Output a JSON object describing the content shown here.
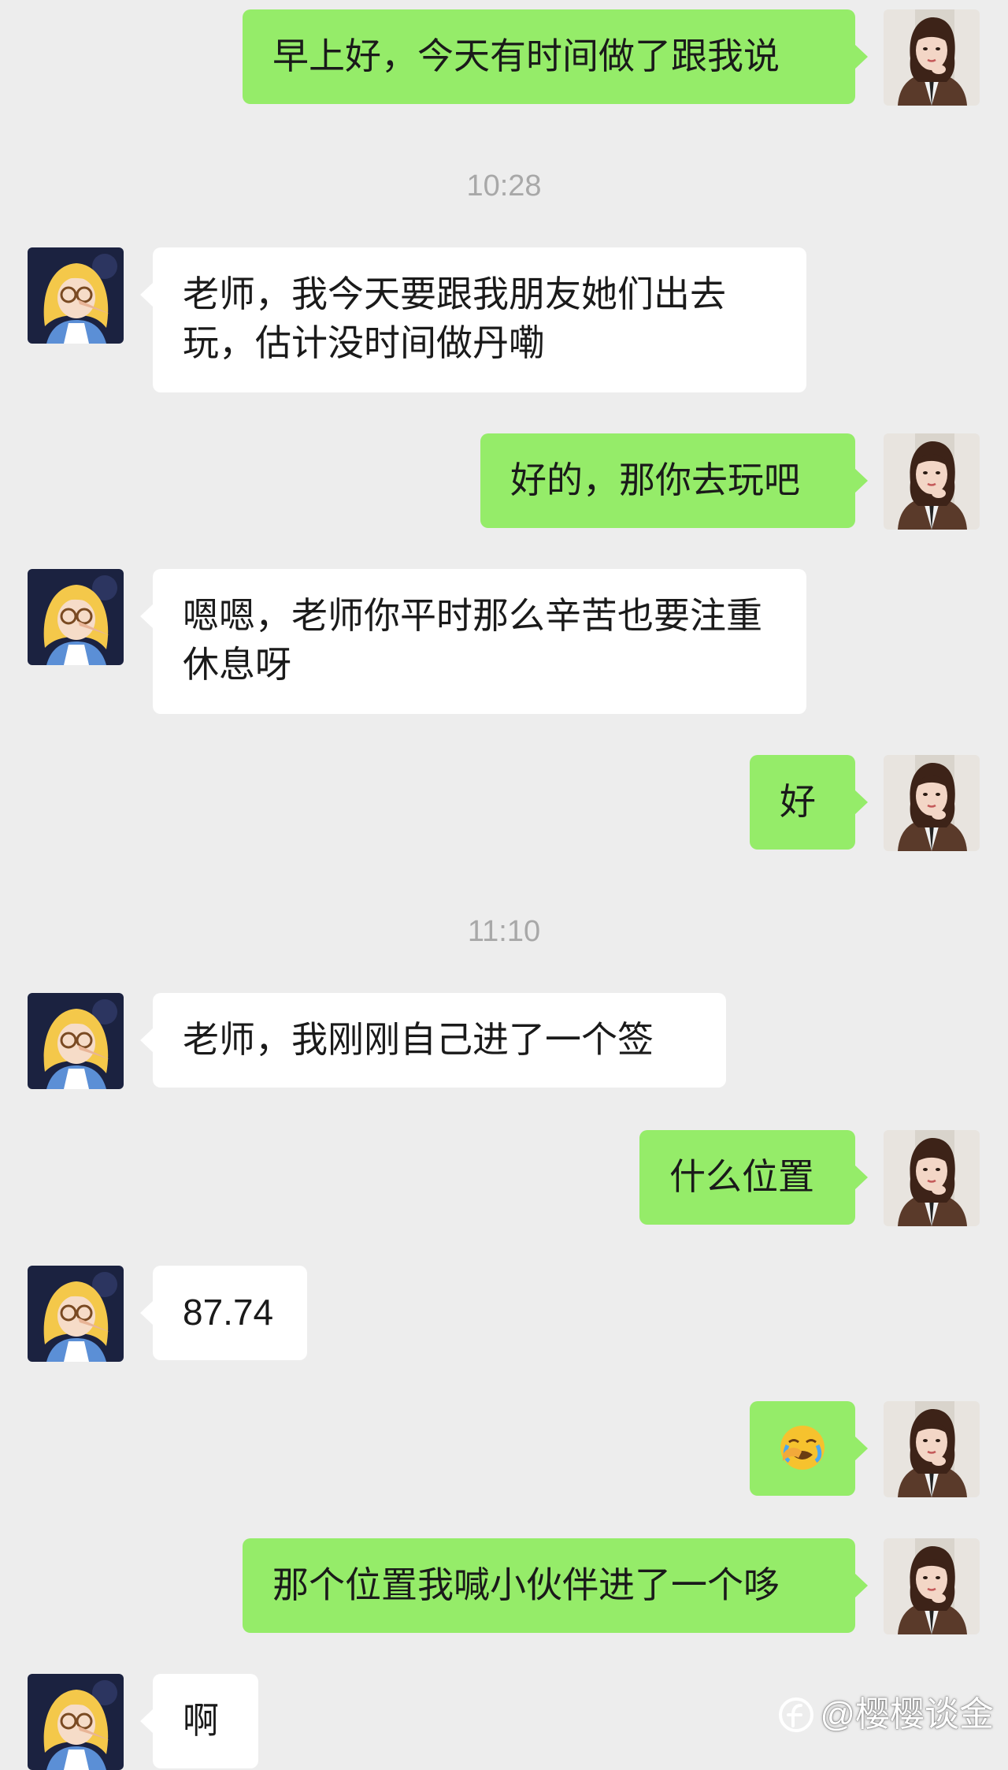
{
  "conversation": {
    "messages": [
      {
        "sender": "me",
        "text": "早上好，今天有时间做了跟我说"
      },
      {
        "type": "timestamp",
        "text": "10:28"
      },
      {
        "sender": "other",
        "text": "老师，我今天要跟我朋友她们出去玩，估计没时间做丹嘞"
      },
      {
        "sender": "me",
        "text": "好的，那你去玩吧"
      },
      {
        "sender": "other",
        "text": "嗯嗯，老师你平时那么辛苦也要注重休息呀"
      },
      {
        "sender": "me",
        "text": "好"
      },
      {
        "type": "timestamp",
        "text": "11:10"
      },
      {
        "sender": "other",
        "text": "老师，我刚刚自己进了一个签"
      },
      {
        "sender": "me",
        "text": "什么位置"
      },
      {
        "sender": "other",
        "text": "87.74"
      },
      {
        "sender": "me",
        "emoji": "facepalm-crying-emoji"
      },
      {
        "sender": "me",
        "text": "那个位置我喊小伙伴进了一个哆"
      },
      {
        "sender": "other",
        "text": "啊"
      }
    ]
  },
  "avatars": {
    "me": "woman-in-brown-blazer-avatar",
    "other": "alice-cartoon-avatar"
  },
  "colors": {
    "background": "#ededed",
    "my_bubble": "#95ec69",
    "their_bubble": "#ffffff",
    "timestamp": "#a8a8a8"
  },
  "watermark": {
    "text": "@樱樱谈金",
    "logo": "platform-logo-icon"
  }
}
